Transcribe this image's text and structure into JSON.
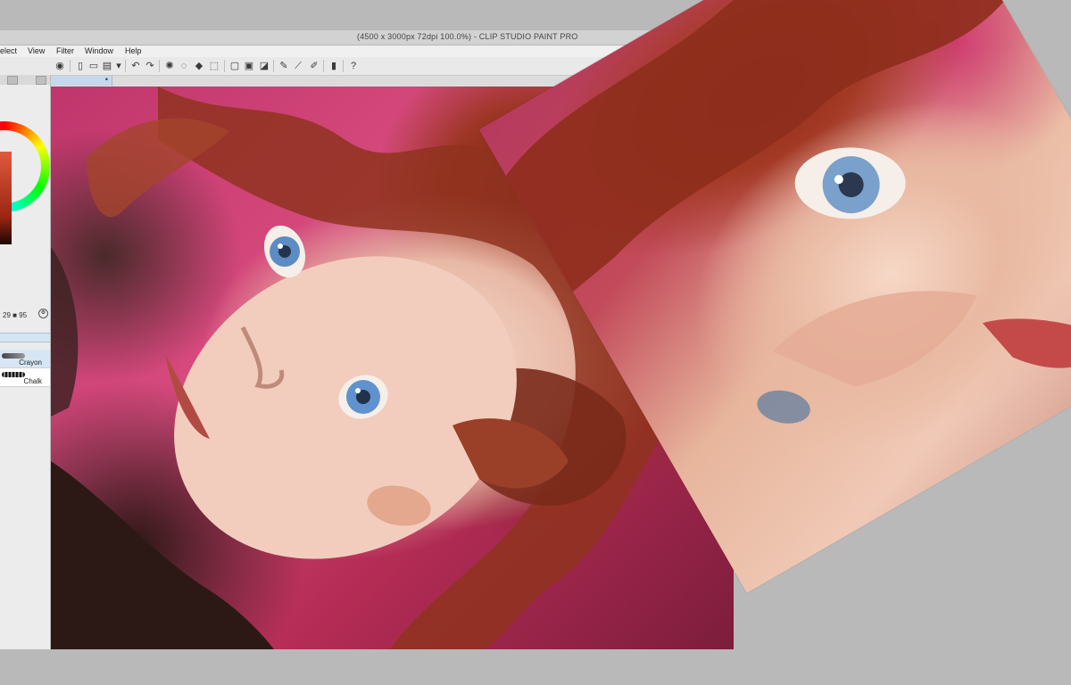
{
  "window": {
    "title": "(4500 x 3000px 72dpi 100.0%) - CLIP STUDIO PAINT PRO"
  },
  "menu": {
    "items": [
      "elect",
      "View",
      "Filter",
      "Window",
      "Help"
    ]
  },
  "toolbar": {
    "icons": [
      "show-hide-icon",
      "new-file-icon",
      "open-file-icon",
      "save-icon",
      "dropdown-icon",
      "undo-icon",
      "redo-icon",
      "loading-icon",
      "clear-icon",
      "fill-icon",
      "transform-icon",
      "deselect-icon",
      "invert-icon",
      "crop-icon",
      "pen-settings-icon",
      "ruler-icon",
      "brush-settings-icon",
      "device-icon",
      "help-icon"
    ]
  },
  "document_tab": {
    "modified_marker": "•"
  },
  "color_panel": {
    "value_a": "29",
    "value_b": "95",
    "current_color": "#9c2612"
  },
  "brush_panel": {
    "items": [
      {
        "label": "Crayon",
        "selected": true
      },
      {
        "label": "Chalk",
        "selected": false
      }
    ]
  },
  "colors": {
    "background": "#b9b9b9",
    "accent": "#c5d8ec",
    "canvas_pink": "#c0356b",
    "hair": "#9c3523"
  }
}
